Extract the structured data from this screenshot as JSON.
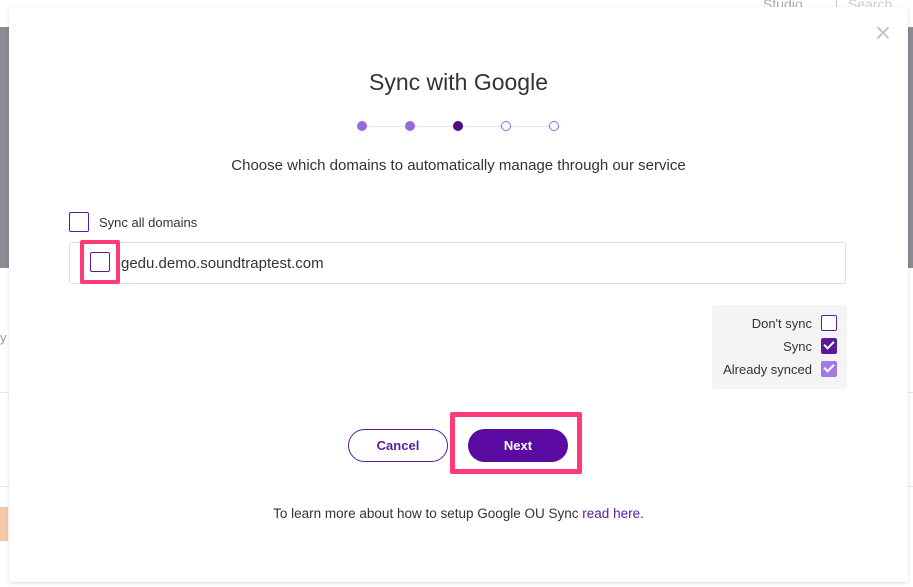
{
  "background": {
    "topbar_item_1": "Studio",
    "topbar_item_2": "Search",
    "side_letter": "y"
  },
  "modal": {
    "title": "Sync with Google",
    "close_glyph": "×",
    "steps": {
      "total": 5,
      "current": 3
    },
    "subtitle": "Choose which domains to automatically manage through our service",
    "sync_all_label": "Sync all domains",
    "domains": [
      {
        "name": "gedu.demo.soundtraptest.com",
        "checked": false
      }
    ],
    "legend": {
      "dont_sync": "Don't sync",
      "sync": "Sync",
      "already_synced": "Already synced"
    },
    "cancel_label": "Cancel",
    "next_label": "Next",
    "footer_text": "To learn more about how to setup Google OU Sync ",
    "footer_link": "read here",
    "footer_end": "."
  },
  "colors": {
    "primary": "#5a0aa0",
    "accent_light": "#9b66e0",
    "highlight": "#ff3a78"
  }
}
